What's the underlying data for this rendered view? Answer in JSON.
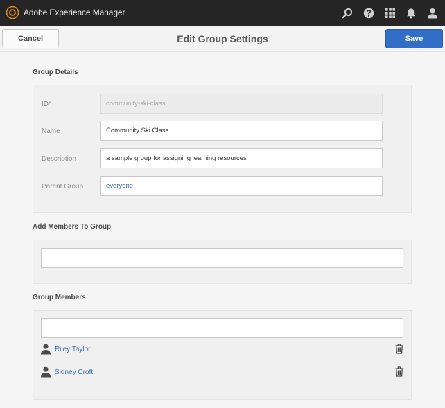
{
  "app": {
    "title": "Adobe Experience Manager",
    "brand_color": "#e68619",
    "topbar_icons": [
      "search-icon",
      "help-icon",
      "apps-grid-icon",
      "bell-icon",
      "user-icon"
    ]
  },
  "actionbar": {
    "cancel_label": "Cancel",
    "title": "Edit Group Settings",
    "save_label": "Save",
    "save_color": "#326ec8"
  },
  "group_details": {
    "heading": "Group Details",
    "id": {
      "label": "ID*",
      "value": "community-ski-class"
    },
    "name": {
      "label": "Name",
      "value": "Community Ski Class"
    },
    "description": {
      "label": "Description",
      "value": "a sample group for assigning learning resources"
    },
    "parent_group": {
      "label": "Parent Group",
      "value": "everyone"
    }
  },
  "add_members": {
    "heading": "Add Members To Group",
    "value": ""
  },
  "group_members": {
    "heading": "Group Members",
    "filter_value": "",
    "members": [
      {
        "name": "Riley Taylor"
      },
      {
        "name": "Sidney Croft"
      }
    ]
  }
}
